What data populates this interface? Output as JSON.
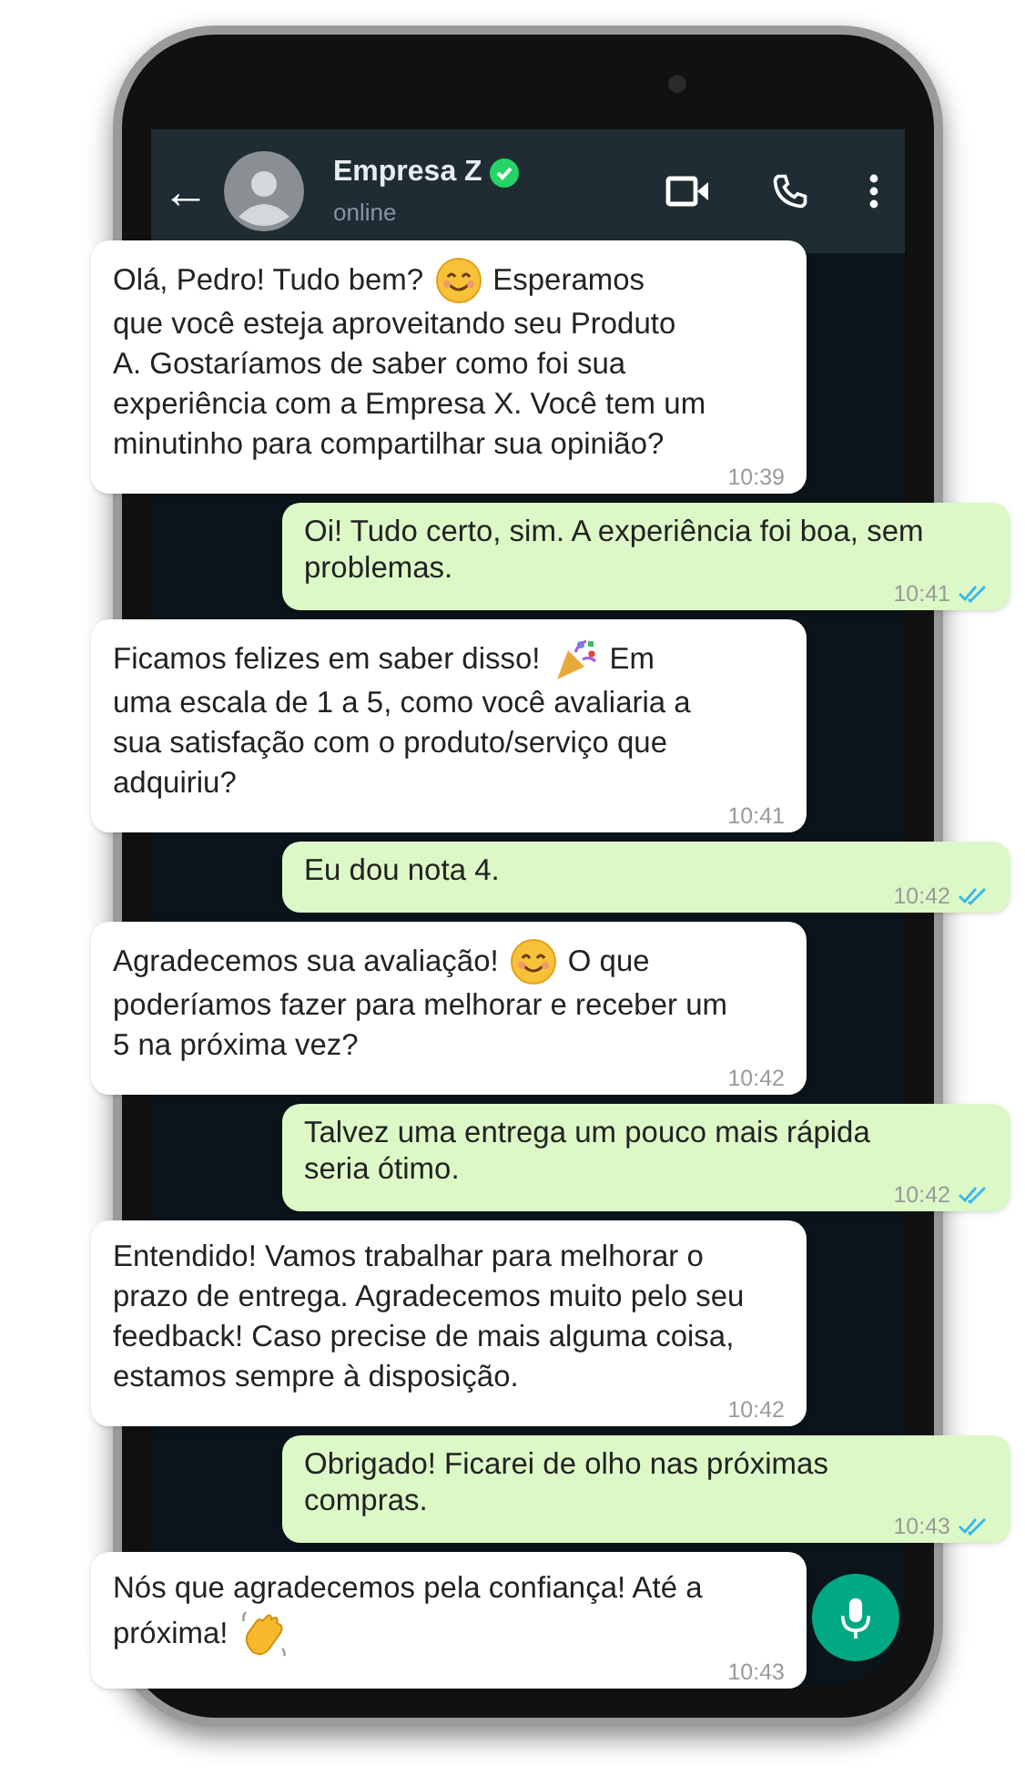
{
  "header": {
    "back": "←",
    "contact_name": "Empresa Z",
    "verified": true,
    "status": "online"
  },
  "messages": [
    {
      "kind": "received",
      "lines": [
        [
          {
            "kind": "text",
            "text": "Olá, Pedro! Tudo bem?"
          },
          {
            "kind": "smile"
          },
          {
            "kind": "text",
            "text": "Esperamos"
          }
        ],
        [
          {
            "kind": "text",
            "text": "que você esteja aproveitando seu Produto"
          }
        ],
        [
          {
            "kind": "text",
            "text": "A. Gostaríamos de saber como foi sua"
          }
        ],
        [
          {
            "kind": "text",
            "text": "experiência com a Empresa X. Você tem um"
          }
        ],
        [
          {
            "kind": "text",
            "text": "minutinho para compartilhar sua opinião?"
          }
        ]
      ],
      "time": "10:39"
    },
    {
      "kind": "sent",
      "lines": [
        [
          {
            "kind": "text",
            "text": "Oi! Tudo certo, sim. A experiência foi boa, sem"
          }
        ],
        [
          {
            "kind": "text",
            "text": "problemas."
          }
        ]
      ],
      "time": "10:41",
      "read": true
    },
    {
      "kind": "received",
      "lines": [
        [
          {
            "kind": "text",
            "text": "Ficamos felizes em saber disso!"
          },
          {
            "kind": "party"
          },
          {
            "kind": "text",
            "text": "Em"
          }
        ],
        [
          {
            "kind": "text",
            "text": "uma escala de 1 a 5, como você avaliaria a"
          }
        ],
        [
          {
            "kind": "text",
            "text": "sua satisfação com o produto/serviço que"
          }
        ],
        [
          {
            "kind": "text",
            "text": "adquiriu?"
          }
        ]
      ],
      "time": "10:41"
    },
    {
      "kind": "sent",
      "lines": [
        [
          {
            "kind": "text",
            "text": "Eu dou nota 4."
          }
        ]
      ],
      "time": "10:42",
      "read": true
    },
    {
      "kind": "received",
      "lines": [
        [
          {
            "kind": "text",
            "text": "Agradecemos sua avaliação!"
          },
          {
            "kind": "smile"
          },
          {
            "kind": "text",
            "text": "O que"
          }
        ],
        [
          {
            "kind": "text",
            "text": "poderíamos fazer para melhorar e receber um"
          }
        ],
        [
          {
            "kind": "text",
            "text": "5 na próxima vez?"
          }
        ]
      ],
      "time": "10:42"
    },
    {
      "kind": "sent",
      "lines": [
        [
          {
            "kind": "text",
            "text": "Talvez uma entrega um pouco mais rápida"
          }
        ],
        [
          {
            "kind": "text",
            "text": "seria ótimo."
          }
        ]
      ],
      "time": "10:42",
      "read": true
    },
    {
      "kind": "received",
      "lines": [
        [
          {
            "kind": "text",
            "text": "Entendido! Vamos trabalhar para melhorar o"
          }
        ],
        [
          {
            "kind": "text",
            "text": "prazo de entrega. Agradecemos muito pelo seu"
          }
        ],
        [
          {
            "kind": "text",
            "text": "feedback! Caso precise de mais alguma coisa,"
          }
        ],
        [
          {
            "kind": "text",
            "text": "estamos sempre à disposição."
          }
        ]
      ],
      "time": "10:42"
    },
    {
      "kind": "sent",
      "lines": [
        [
          {
            "kind": "text",
            "text": "Obrigado! Ficarei de olho nas próximas"
          }
        ],
        [
          {
            "kind": "text",
            "text": "compras."
          }
        ]
      ],
      "time": "10:43",
      "read": true
    },
    {
      "kind": "received",
      "lines": [
        [
          {
            "kind": "text",
            "text": "Nós que agradecemos pela confiança! Até a"
          }
        ],
        [
          {
            "kind": "text",
            "text": "próxima!"
          },
          {
            "kind": "wave"
          }
        ]
      ],
      "time": "10:43"
    }
  ]
}
